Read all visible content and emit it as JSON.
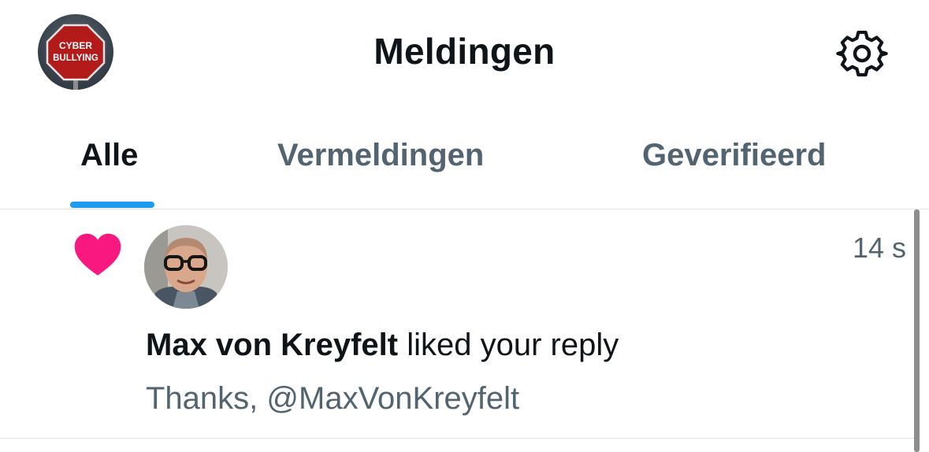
{
  "header": {
    "title": "Meldingen",
    "profile_avatar": {
      "sign_line1": "CYBER",
      "sign_line2": "BULLYING"
    },
    "settings_icon": "gear-icon"
  },
  "tabs": [
    {
      "label": "Alle",
      "active": true
    },
    {
      "label": "Vermeldingen",
      "active": false
    },
    {
      "label": "Geverifieerd",
      "active": false
    }
  ],
  "notification": {
    "type_icon": "heart-icon",
    "type_icon_color": "#f91880",
    "timestamp": "14 s",
    "user_name": "Max von Kreyfelt",
    "action_text": "liked your reply",
    "reply_preview": "Thanks, @MaxVonKreyfelt"
  },
  "colors": {
    "accent": "#1d9bf0",
    "secondary_text": "#536471",
    "like": "#f91880"
  }
}
